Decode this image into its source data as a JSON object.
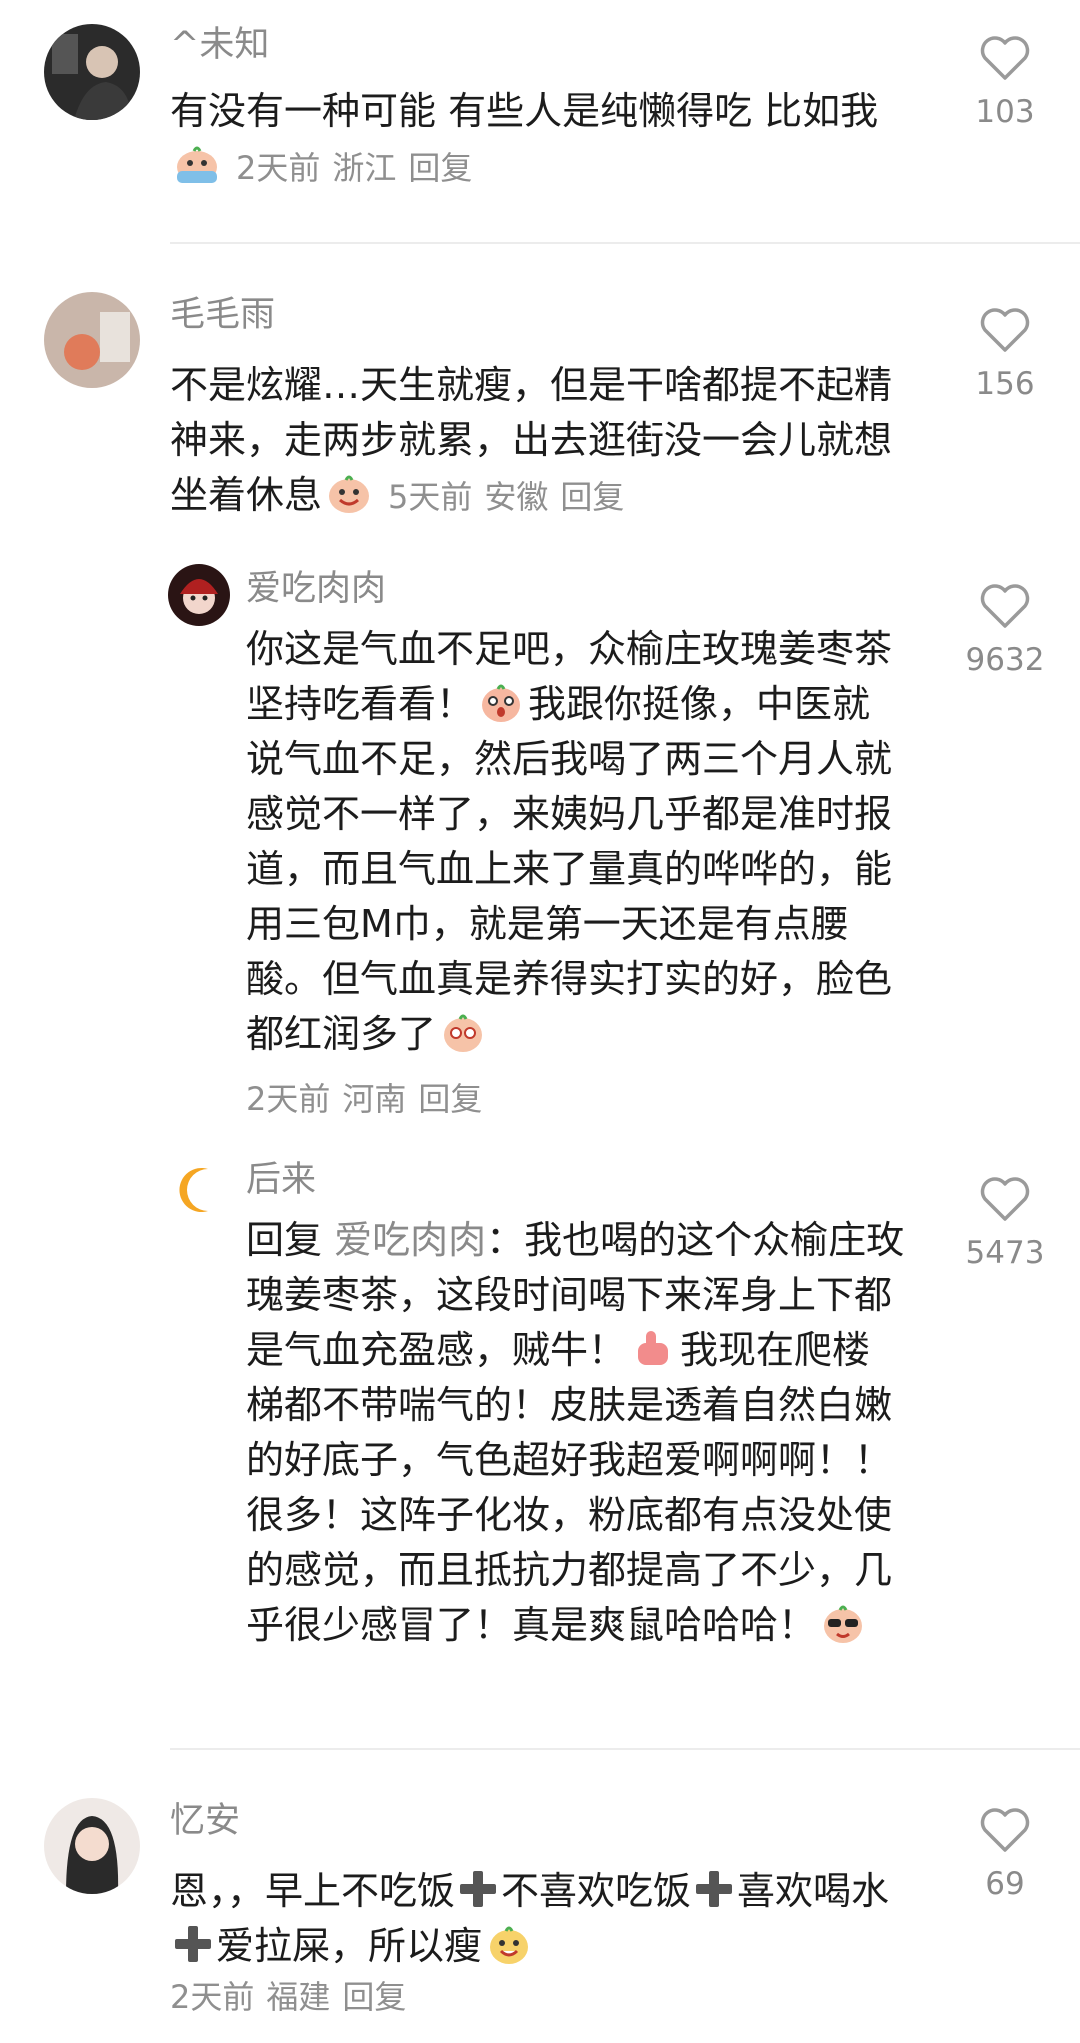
{
  "comments": [
    {
      "username": "^未知",
      "text": "有没有一种可能 有些人是纯懒得吃 比如我",
      "time": "2天前",
      "location": "浙江",
      "reply_label": "回复",
      "likes": "103"
    },
    {
      "username": "毛毛雨",
      "text": "不是炫耀…天生就瘦，但是干啥都提不起精神来，走两步就累，出去逛街没一会儿就想坐着休息",
      "time": "5天前",
      "location": "安徽",
      "reply_label": "回复",
      "likes": "156",
      "replies": [
        {
          "username": "爱吃肉肉",
          "text_a": "你这是气血不足吧，众榆庄玫瑰姜枣茶坚持吃看看！",
          "text_b": "我跟你挺像，中医就说气血不足，然后我喝了两三个月人就感觉不一样了，来姨妈几乎都是准时报道，而且气血上来了量真的哗哗的，能用三包M巾，就是第一天还是有点腰酸。但气血真是养得实打实的好，脸色都红润多了",
          "time": "2天前",
          "location": "河南",
          "reply_label": "回复",
          "likes": "9632"
        },
        {
          "username": "后来",
          "reply_prefix": "回复",
          "mention": "爱吃肉肉",
          "text_a": "：我也喝的这个众榆庄玫瑰姜枣茶，这段时间喝下来浑身上下都是气血充盈感，贼牛！",
          "text_b": "我现在爬楼梯都不带喘气的！皮肤是透着自然白嫩的好底子，气色超好我超爱啊啊啊！！很多！这阵子化妆，粉底都有点没处使的感觉，而且抵抗力都提高了不少，几乎很少感冒了！真是爽鼠哈哈哈！",
          "likes": "5473"
        }
      ]
    },
    {
      "username": "忆安",
      "text_a": "恩，，早上不吃饭",
      "text_b": "不喜欢吃饭",
      "text_c": "喜欢喝水",
      "text_d": "爱拉屎，所以瘦",
      "time": "2天前",
      "location": "福建",
      "reply_label": "回复",
      "likes": "69"
    }
  ],
  "icons": {
    "like": "heart-outline-icon",
    "plus": "heavy-plus-icon"
  },
  "colors": {
    "text": "#1c1c1c",
    "secondary": "#8a8a8a",
    "divider": "#ececec"
  }
}
